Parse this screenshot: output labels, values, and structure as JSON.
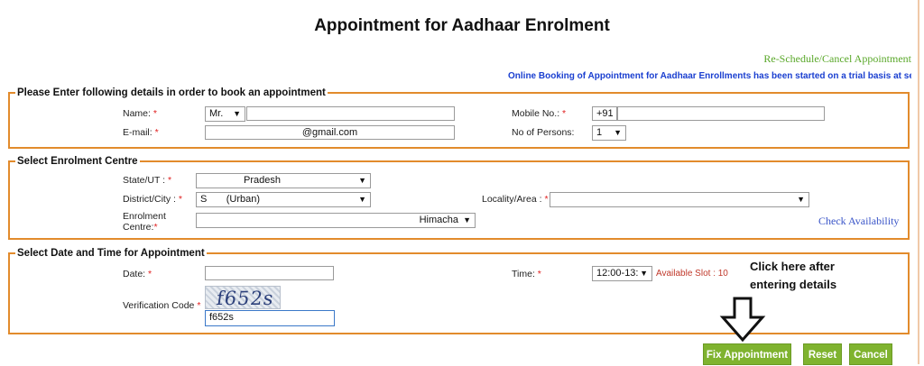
{
  "page_title": "Appointment for Aadhaar Enrolment",
  "reschedule_link": "Re-Schedule/Cancel Appointment",
  "notice_marquee": "Online Booking of Appointment for Aadhaar Enrollments has been started on a trial basis at sel",
  "personal": {
    "legend": "Please Enter following details in order to book an appointment",
    "name_label": "Name:",
    "title_value": "Mr.",
    "name_value": "",
    "email_label": "E-mail:",
    "email_value": "@gmail.com",
    "mobile_label": "Mobile No.:",
    "mobile_prefix": "+91",
    "mobile_value": "",
    "persons_label": "No of Persons:",
    "persons_value": "1"
  },
  "centre": {
    "legend": "Select Enrolment Centre",
    "state_label": "State/UT :",
    "state_value": "Pradesh",
    "district_label": "District/City :",
    "district_value": "S       (Urban)",
    "locality_label": "Locality/Area :",
    "locality_value": "",
    "enrolment_label_line1": "Enrolment",
    "enrolment_label_line2": "Centre:",
    "enrolment_value": "Himacha",
    "check_availability": "Check Availability"
  },
  "datetime": {
    "legend": "Select Date and Time for Appointment",
    "date_label": "Date:",
    "date_value": "",
    "time_label": "Time:",
    "time_value": "12:00-13:",
    "available_slot": "Available Slot : 10",
    "verification_label": "Verification Code",
    "captcha_text": "f652s",
    "verification_value": "f652s"
  },
  "hint": {
    "line1": "Click here after",
    "line2": "entering details"
  },
  "buttons": {
    "fix": "Fix Appointment",
    "reset": "Reset",
    "cancel": "Cancel"
  },
  "required_mark": "*",
  "caret": "▼",
  "colors": {
    "section_border": "#e28b2c",
    "button_green": "#7fb32f",
    "required_red": "#e02020",
    "link_green": "#5aa82a",
    "notice_blue": "#1a3fd0"
  }
}
